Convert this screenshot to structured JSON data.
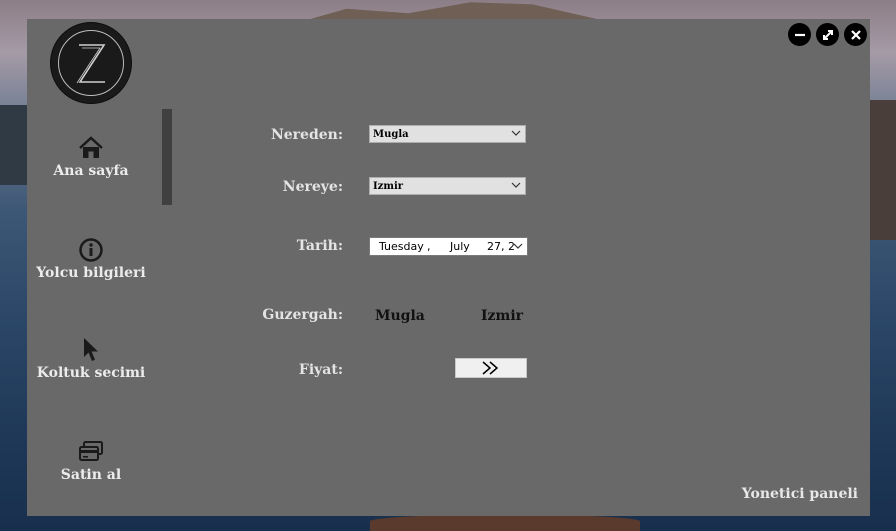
{
  "sidebar": {
    "items": [
      {
        "label": "Ana sayfa",
        "icon": "home-icon"
      },
      {
        "label": "Yolcu bilgileri",
        "icon": "info-icon"
      },
      {
        "label": "Koltuk secimi",
        "icon": "cursor-arrow-icon"
      },
      {
        "label": "Satin al",
        "icon": "credit-card-icon"
      }
    ]
  },
  "form": {
    "from_label": "Nereden:",
    "from_value": "Mugla",
    "to_label": "Nereye:",
    "to_value": "Izmir",
    "date_label": "Tarih:",
    "date_weekday": "Tuesday",
    "date_sep": ",",
    "date_month": "July",
    "date_day": "27, 2",
    "route_label": "Guzergah:",
    "route_from": "Mugla",
    "route_to": "Izmir",
    "price_label": "Fiyat:"
  },
  "footer": {
    "admin_link": "Yonetici paneli"
  },
  "colors": {
    "window_bg": "#696969",
    "nav_indicator": "#404040",
    "text_light": "#e4e4e4"
  }
}
